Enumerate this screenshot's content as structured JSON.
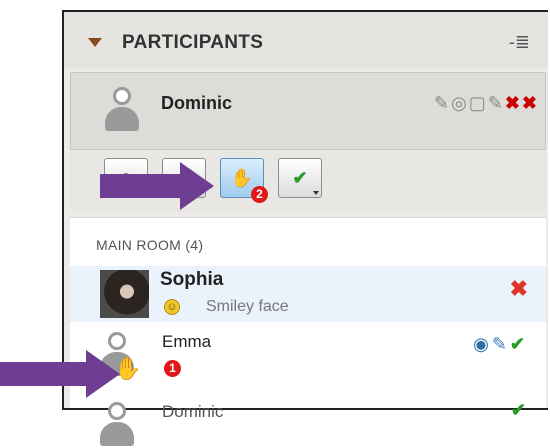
{
  "panel": {
    "title": "PARTICIPANTS",
    "menu_icon": "panel-menu-icon"
  },
  "me": {
    "name": "Dominic",
    "status_icons": [
      "microphone-icon",
      "webcam-icon",
      "chat-icon",
      "pencil-icon",
      "app-share-disabled-icon",
      "web-tour-disabled-icon"
    ]
  },
  "toolbar": {
    "buttons": [
      {
        "name": "emoticon-button",
        "icon": "emoticon-icon"
      },
      {
        "name": "away-button",
        "icon": "clock-icon"
      },
      {
        "name": "raise-hand-button",
        "icon": "raised-hand-icon",
        "badge": "2",
        "active": true
      },
      {
        "name": "feedback-button",
        "icon": "check-icon"
      }
    ]
  },
  "room": {
    "label": "MAIN ROOM (4)",
    "participants": [
      {
        "name": "Sophia",
        "status": "Smiley face",
        "action": "remove"
      },
      {
        "name": "Emma",
        "badge": "1",
        "icons": [
          "webcam-icon",
          "microphone-icon",
          "check-icon"
        ]
      },
      {
        "name": "Dominic"
      }
    ]
  },
  "colors": {
    "accent": "#6f3e92",
    "alert": "#e01818",
    "ok": "#2a9a2a"
  }
}
